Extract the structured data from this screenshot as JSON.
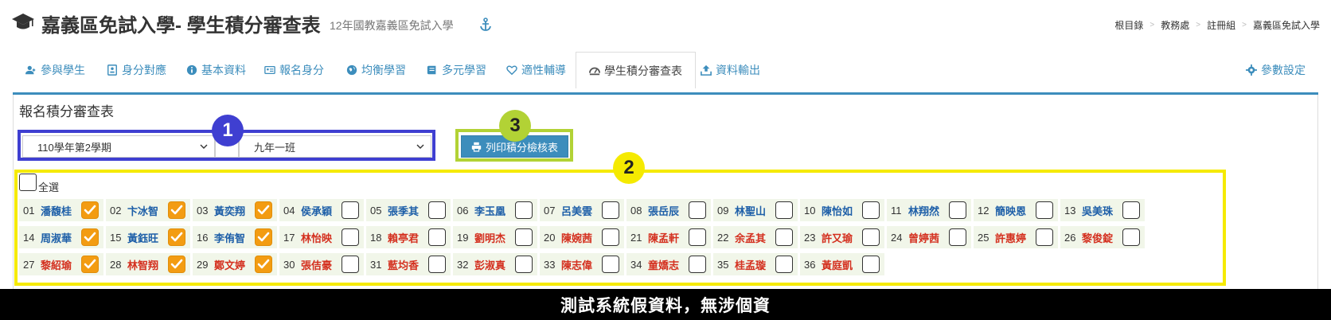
{
  "header": {
    "title": "嘉義區免試入學- 學生積分審查表",
    "subtitle": "12年國教嘉義區免試入學",
    "breadcrumb": [
      "根目錄",
      "教務處",
      "註冊組",
      "嘉義區免試入學"
    ]
  },
  "tabs": [
    {
      "label": "參與學生",
      "icon": "users-icon"
    },
    {
      "label": "身分對應",
      "icon": "id-icon"
    },
    {
      "label": "基本資料",
      "icon": "info-icon"
    },
    {
      "label": "報名身分",
      "icon": "card-icon"
    },
    {
      "label": "均衡學習",
      "icon": "globe-icon"
    },
    {
      "label": "多元學習",
      "icon": "book-icon"
    },
    {
      "label": "適性輔導",
      "icon": "heart-icon"
    },
    {
      "label": "學生積分審查表",
      "icon": "dashboard-icon",
      "active": true
    },
    {
      "label": "資料輸出",
      "icon": "export-icon"
    }
  ],
  "settings_label": "參數設定",
  "panel": {
    "title": "報名積分審查表",
    "semester_value": "110學年第2學期",
    "class_value": "九年一班",
    "print_button": "列印積分檢核表",
    "select_all": "全選"
  },
  "annotations": {
    "one": "1",
    "two": "2",
    "three": "3"
  },
  "students": [
    {
      "num": "01",
      "name": "潘馥桂",
      "g": "m",
      "checked": true
    },
    {
      "num": "02",
      "name": "卞冰智",
      "g": "m",
      "checked": true
    },
    {
      "num": "03",
      "name": "黃奕翔",
      "g": "m",
      "checked": true
    },
    {
      "num": "04",
      "name": "侯承穎",
      "g": "m",
      "checked": false
    },
    {
      "num": "05",
      "name": "張季其",
      "g": "m",
      "checked": false
    },
    {
      "num": "06",
      "name": "李玉凰",
      "g": "m",
      "checked": false
    },
    {
      "num": "07",
      "name": "呂美雲",
      "g": "m",
      "checked": false
    },
    {
      "num": "08",
      "name": "張岳辰",
      "g": "m",
      "checked": false
    },
    {
      "num": "09",
      "name": "林聖山",
      "g": "m",
      "checked": false
    },
    {
      "num": "10",
      "name": "陳怡如",
      "g": "m",
      "checked": false
    },
    {
      "num": "11",
      "name": "林翔然",
      "g": "m",
      "checked": false
    },
    {
      "num": "12",
      "name": "簡映恩",
      "g": "m",
      "checked": false
    },
    {
      "num": "13",
      "name": "吳美珠",
      "g": "m",
      "checked": false
    },
    {
      "num": "14",
      "name": "周淑華",
      "g": "m",
      "checked": true
    },
    {
      "num": "15",
      "name": "黃鈺旺",
      "g": "m",
      "checked": true
    },
    {
      "num": "16",
      "name": "李侑智",
      "g": "m",
      "checked": true
    },
    {
      "num": "17",
      "name": "林怡映",
      "g": "f",
      "checked": false
    },
    {
      "num": "18",
      "name": "賴亭君",
      "g": "f",
      "checked": false
    },
    {
      "num": "19",
      "name": "劉明杰",
      "g": "f",
      "checked": false
    },
    {
      "num": "20",
      "name": "陳婉茜",
      "g": "f",
      "checked": false
    },
    {
      "num": "21",
      "name": "陳孟軒",
      "g": "f",
      "checked": false
    },
    {
      "num": "22",
      "name": "余孟其",
      "g": "f",
      "checked": false
    },
    {
      "num": "23",
      "name": "許又瑜",
      "g": "f",
      "checked": false
    },
    {
      "num": "24",
      "name": "曾婷茜",
      "g": "f",
      "checked": false
    },
    {
      "num": "25",
      "name": "許惠婷",
      "g": "f",
      "checked": false
    },
    {
      "num": "26",
      "name": "黎俊錠",
      "g": "f",
      "checked": false
    },
    {
      "num": "27",
      "name": "黎紹瑜",
      "g": "f",
      "checked": true
    },
    {
      "num": "28",
      "name": "林智翔",
      "g": "f",
      "checked": true
    },
    {
      "num": "29",
      "name": "鄭文婷",
      "g": "f",
      "checked": true
    },
    {
      "num": "30",
      "name": "張佶豪",
      "g": "f",
      "checked": false
    },
    {
      "num": "31",
      "name": "藍均香",
      "g": "f",
      "checked": false
    },
    {
      "num": "32",
      "name": "彭淑真",
      "g": "f",
      "checked": false
    },
    {
      "num": "33",
      "name": "陳志偉",
      "g": "f",
      "checked": false
    },
    {
      "num": "34",
      "name": "童嬌志",
      "g": "f",
      "checked": false
    },
    {
      "num": "35",
      "name": "桂孟璇",
      "g": "f",
      "checked": false
    },
    {
      "num": "36",
      "name": "黃庭凱",
      "g": "f",
      "checked": false
    }
  ],
  "footer_text": "測試系統假資料，無涉個資",
  "colors": {
    "accent": "#3c8dbc",
    "checked": "#f39c12",
    "male": "#1e5fa8",
    "female": "#d4301f",
    "hl_blue": "#3f3fd1",
    "hl_yellow": "#f5ea00",
    "hl_green": "#b2d235"
  }
}
